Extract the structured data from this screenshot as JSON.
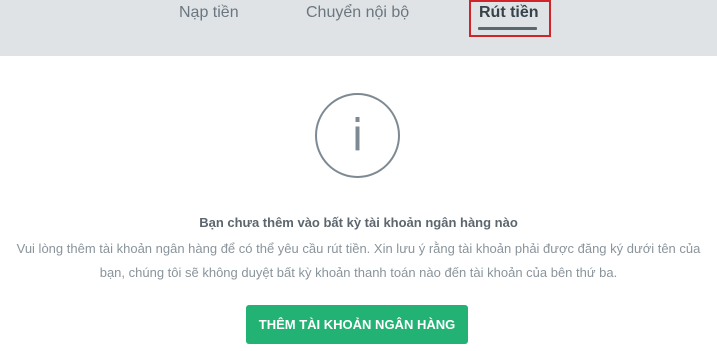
{
  "tabs": {
    "deposit": "Nạp tiền",
    "internal_transfer": "Chuyển nội bộ",
    "withdraw": "Rút tiền"
  },
  "empty_state": {
    "icon": "info-icon",
    "icon_glyph": "i",
    "headline": "Bạn chưa thêm vào bất kỳ tài khoản ngân hàng nào",
    "description_line1": "Vui lòng thêm tài khoản ngân hàng để có thể yêu cầu rút tiền. Xin lưu ý rằng tài khoản phải được đăng ký dưới tên của",
    "description_line2": "bạn, chúng tôi sẽ không duyệt bất kỳ khoản thanh toán nào đến tài khoản của bên thứ ba.",
    "button_label": "THÊM TÀI KHOẢN NGÂN HÀNG"
  },
  "colors": {
    "tabbar_bg": "#dfe3e6",
    "active_highlight": "#d0242b",
    "button_bg": "#22b374"
  }
}
